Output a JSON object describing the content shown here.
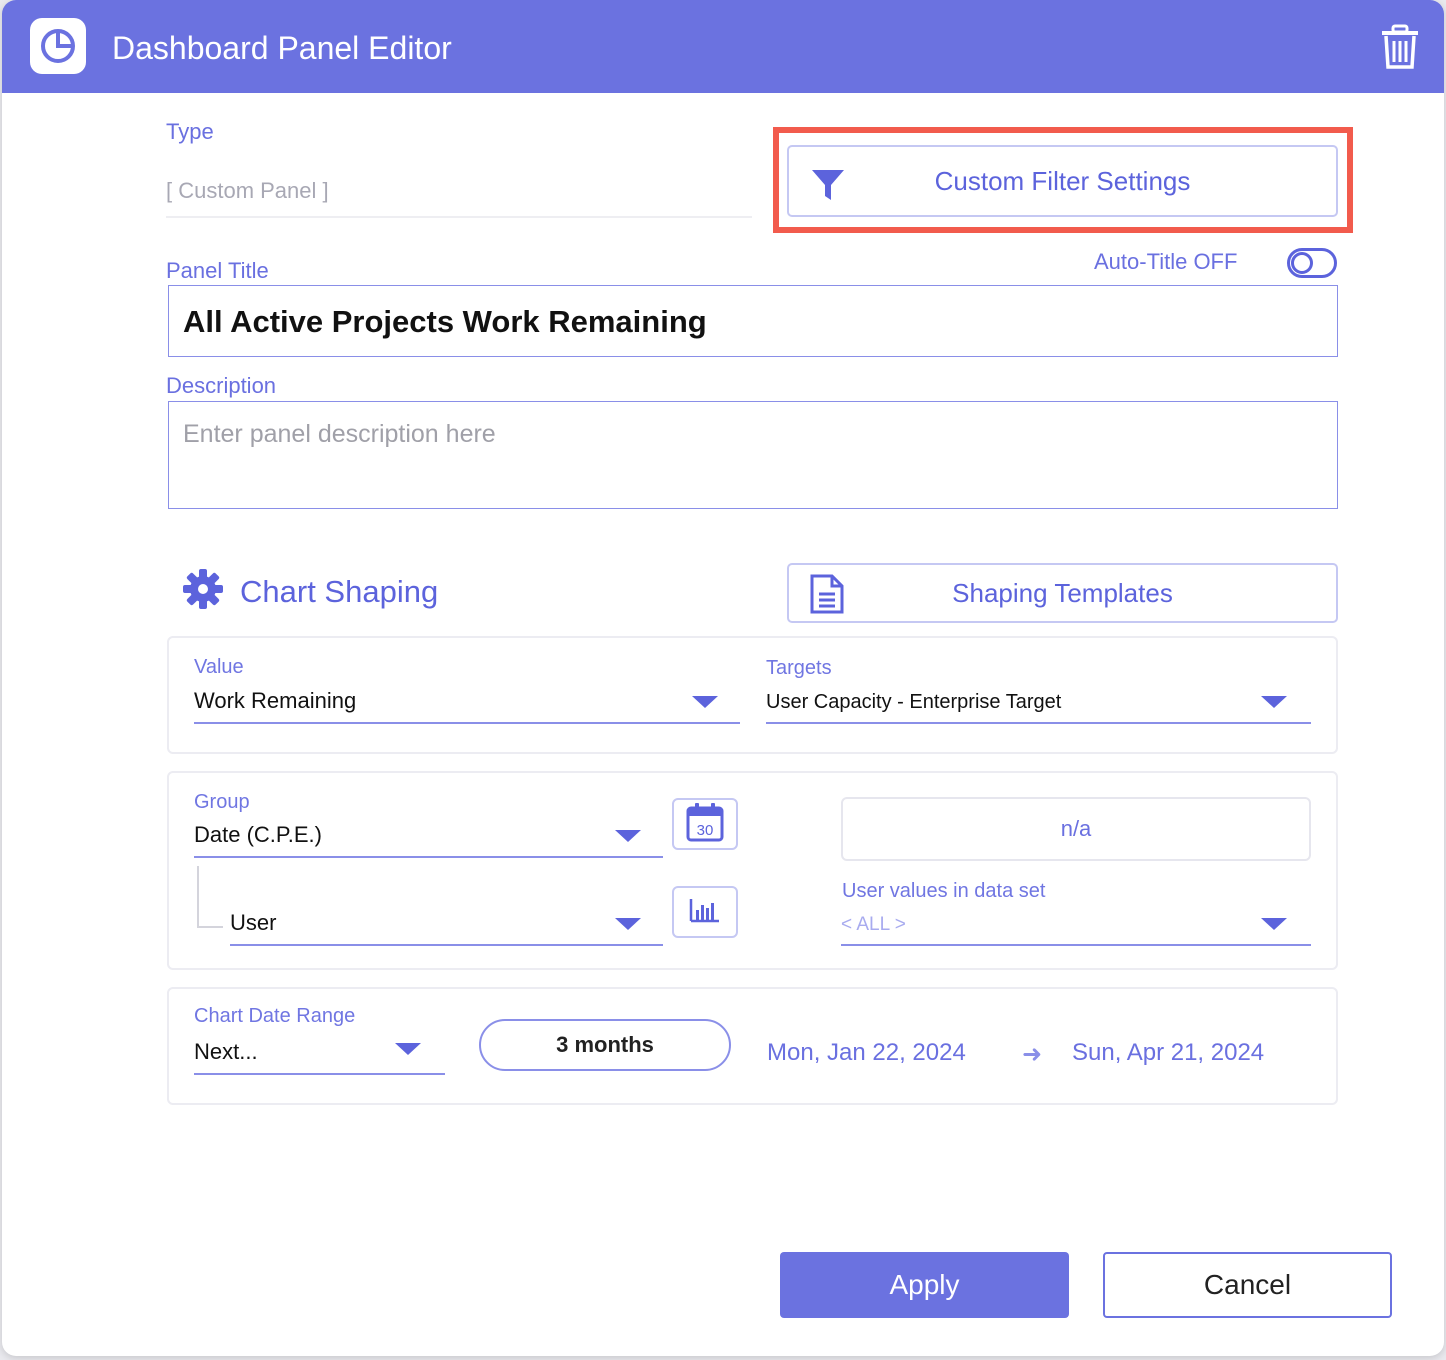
{
  "dialog": {
    "title": "Dashboard Panel Editor",
    "icons": {
      "logo": "pie-chart-icon",
      "delete": "trash-icon"
    }
  },
  "type_field": {
    "label": "Type",
    "value": "[ Custom Panel ]"
  },
  "custom_filter": {
    "label": "Custom Filter Settings",
    "icon": "filter-icon"
  },
  "auto_title": {
    "label": "Auto-Title OFF",
    "on": false
  },
  "panel_title": {
    "label": "Panel Title",
    "value": "All Active Projects Work Remaining"
  },
  "description": {
    "label": "Description",
    "placeholder": "Enter panel description here"
  },
  "chart_shaping": {
    "heading": "Chart Shaping",
    "icon": "gear-icon",
    "templates_button": {
      "label": "Shaping Templates",
      "icon": "document-icon"
    }
  },
  "value_card": {
    "value": {
      "label": "Value",
      "selected": "Work Remaining"
    },
    "targets": {
      "label": "Targets",
      "selected": "User Capacity - Enterprise Target"
    }
  },
  "group_card": {
    "group": {
      "label": "Group",
      "selected": "Date (C.P.E.)",
      "icon_text": "30"
    },
    "subgroup": {
      "selected": "User"
    },
    "na_box": "n/a",
    "user_values": {
      "label": "User values in data set",
      "selected": "< ALL >"
    }
  },
  "date_range": {
    "label": "Chart Date Range",
    "mode": "Next...",
    "duration": "3 months",
    "start": "Mon, Jan 22, 2024",
    "arrow": "➜",
    "end": "Sun, Apr 21, 2024"
  },
  "footer": {
    "apply": "Apply",
    "cancel": "Cancel"
  },
  "colors": {
    "accent": "#6b72e0",
    "highlight": "#f25b4d"
  }
}
